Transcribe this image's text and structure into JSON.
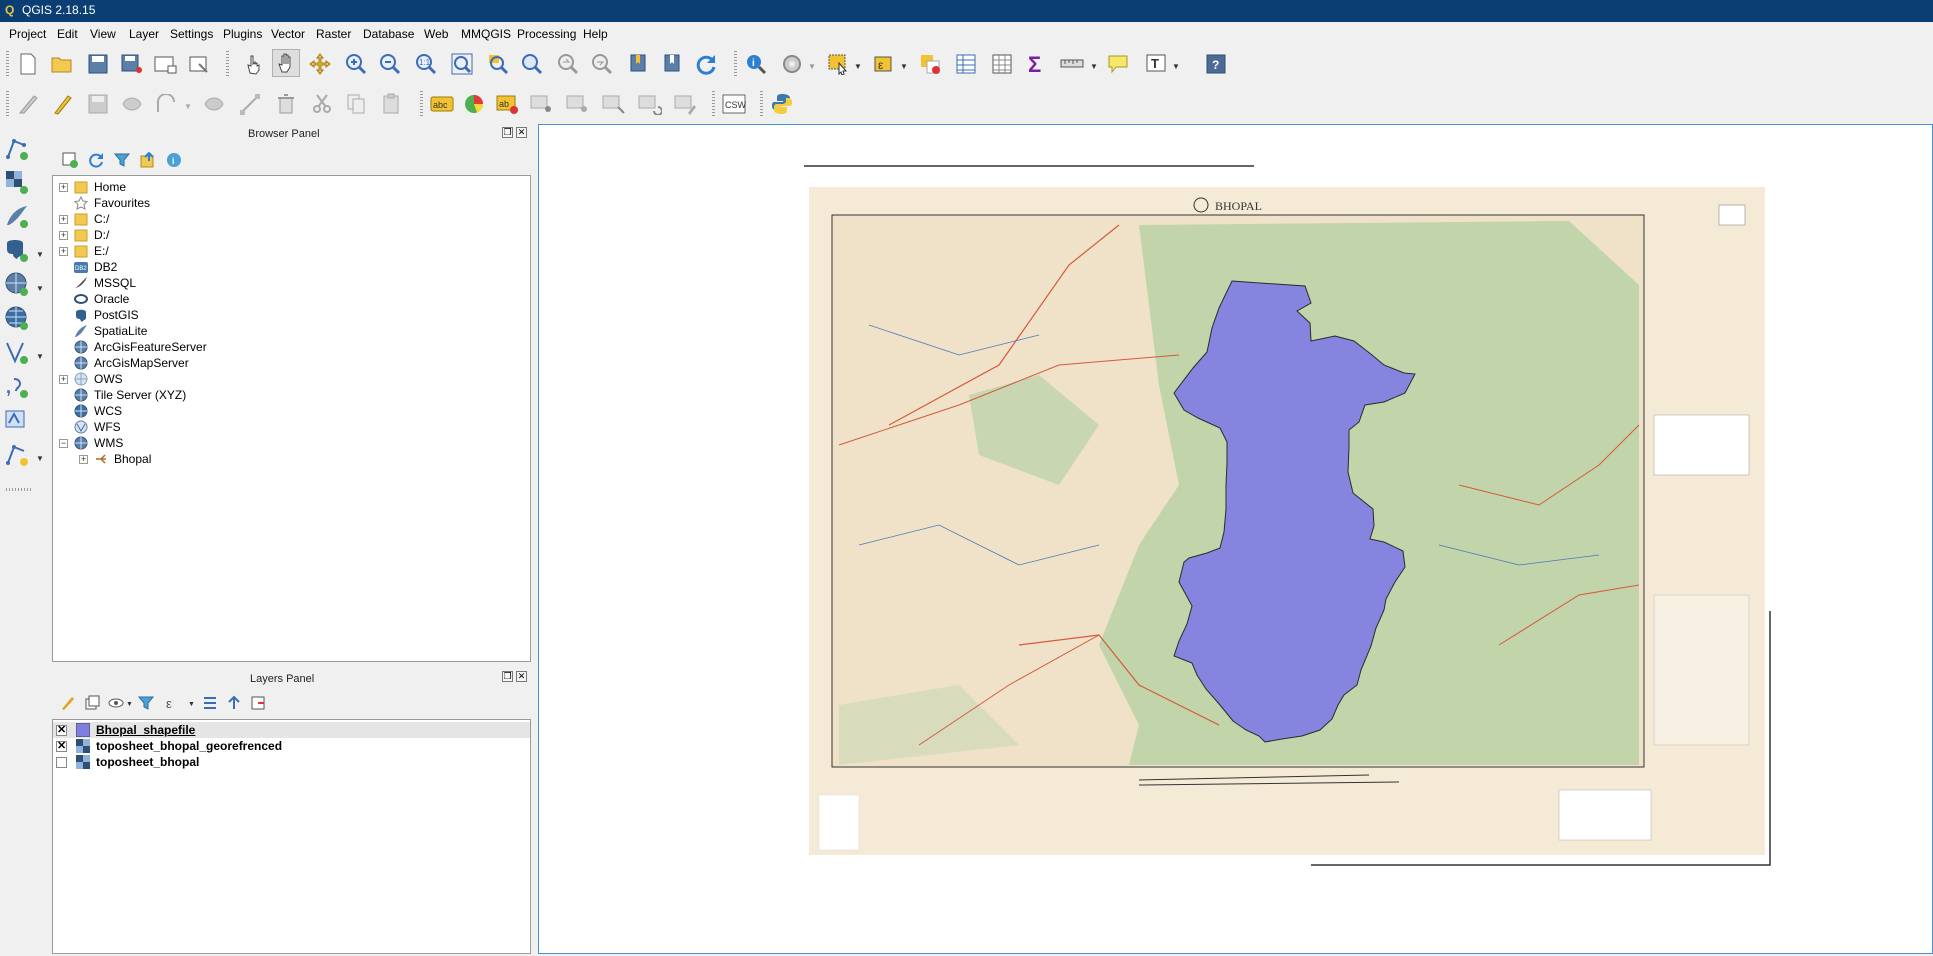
{
  "app": {
    "title": "QGIS 2.18.15"
  },
  "menu": [
    "Project",
    "Edit",
    "View",
    "Layer",
    "Settings",
    "Plugins",
    "Vector",
    "Raster",
    "Database",
    "Web",
    "MMQGIS",
    "Processing",
    "Help"
  ],
  "toolbar": {
    "csw_label": "CSW",
    "abc_label": "abc"
  },
  "browser_panel": {
    "title": "Browser Panel",
    "items": [
      {
        "label": "Home",
        "icon": "folder-icon",
        "expandable": true
      },
      {
        "label": "Favourites",
        "icon": "star-icon",
        "expandable": false
      },
      {
        "label": "C:/",
        "icon": "folder-icon",
        "expandable": true
      },
      {
        "label": "D:/",
        "icon": "folder-icon",
        "expandable": true
      },
      {
        "label": "E:/",
        "icon": "folder-icon",
        "expandable": true
      },
      {
        "label": "DB2",
        "icon": "db2-icon",
        "expandable": false
      },
      {
        "label": "MSSQL",
        "icon": "mssql-icon",
        "expandable": false
      },
      {
        "label": "Oracle",
        "icon": "oracle-icon",
        "expandable": false
      },
      {
        "label": "PostGIS",
        "icon": "postgis-icon",
        "expandable": false
      },
      {
        "label": "SpatiaLite",
        "icon": "spatialite-icon",
        "expandable": false
      },
      {
        "label": "ArcGisFeatureServer",
        "icon": "globe-icon",
        "expandable": false
      },
      {
        "label": "ArcGisMapServer",
        "icon": "globe-icon",
        "expandable": false
      },
      {
        "label": "OWS",
        "icon": "globe-icon",
        "expandable": true
      },
      {
        "label": "Tile Server (XYZ)",
        "icon": "globe-icon",
        "expandable": false
      },
      {
        "label": "WCS",
        "icon": "globe-icon",
        "expandable": false
      },
      {
        "label": "WFS",
        "icon": "globe-icon",
        "expandable": false
      },
      {
        "label": "WMS",
        "icon": "globe-icon",
        "expandable": true,
        "expanded": true
      },
      {
        "label": "Bhopal",
        "icon": "wms-connection-icon",
        "expandable": true,
        "child": true
      }
    ]
  },
  "layers_panel": {
    "title": "Layers Panel",
    "layers": [
      {
        "name": "Bhopal_shapefile",
        "checked": true,
        "selected": true,
        "underline": true
      },
      {
        "name": "toposheet_bhopal_georefrenced",
        "checked": true,
        "selected": false,
        "underline": false
      },
      {
        "name": "toposheet_bhopal",
        "checked": false,
        "selected": false,
        "underline": false
      }
    ]
  },
  "map": {
    "sheet_title": "BHOPAL",
    "polygon_color": "#8585e0",
    "accent": "#0b3f73"
  }
}
